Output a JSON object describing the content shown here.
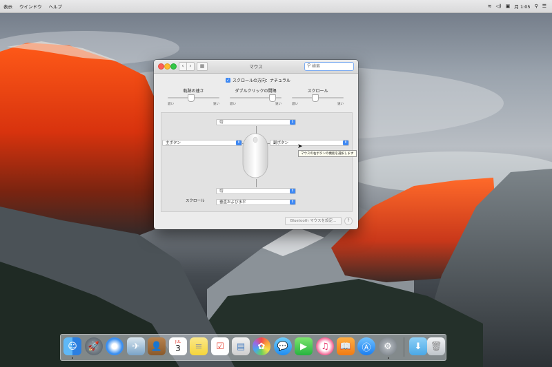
{
  "menubar": {
    "items": [
      "表示",
      "ウインドウ",
      "ヘルプ"
    ],
    "clock": "月 1:05"
  },
  "window": {
    "title": "マウス",
    "search": {
      "placeholder": "検索"
    },
    "natural_scroll_label": "スクロールの方向：ナチュラル",
    "natural_scroll_checked": true,
    "sliders": [
      {
        "title": "軌跡の速さ",
        "min_label": "遅い",
        "max_label": "速い",
        "value": 0.45
      },
      {
        "title": "ダブルクリックの間隔",
        "min_label": "遅い",
        "max_label": "速い",
        "value": 0.82
      },
      {
        "title": "スクロール",
        "min_label": "遅い",
        "max_label": "速い",
        "value": 0.45
      }
    ],
    "popups": {
      "top": "切",
      "left": "主ボタン",
      "right": "副ボタン",
      "bottom": "切",
      "scroll": "垂直および水平"
    },
    "tooltip": "マウスの右ボタンの機能を選択します",
    "scroll_label": "スクロール",
    "bluetooth_button": "Bluetooth マウスを設定...",
    "help_button": "?"
  },
  "dock": {
    "icons": [
      "finder-icon",
      "launchpad-icon",
      "safari-icon",
      "mail-icon",
      "contacts-icon",
      "calendar-icon",
      "notes-icon",
      "reminders-icon",
      "preview-icon",
      "photos-icon",
      "messages-icon",
      "facetime-icon",
      "itunes-icon",
      "ibooks-icon",
      "app-store-icon",
      "system-preferences-icon",
      "downloads-folder-icon",
      "trash-icon"
    ],
    "calendar_month": "JUL",
    "calendar_day": "3"
  },
  "colors": {
    "accent": "#3e88f3",
    "close": "#fc5f57",
    "minimize": "#fdbc2e",
    "zoom": "#33c748"
  }
}
